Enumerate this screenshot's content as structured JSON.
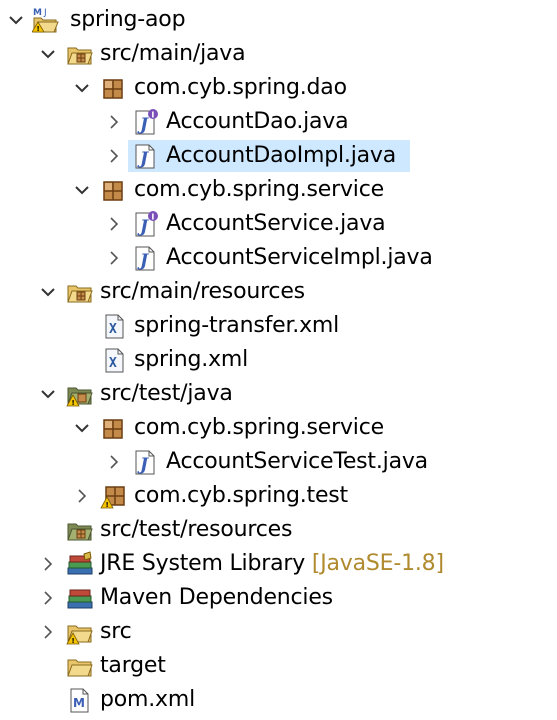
{
  "tree": {
    "project": "spring-aop",
    "main_java": "src/main/java",
    "pkg_dao": "com.cyb.spring.dao",
    "account_dao": "AccountDao.java",
    "account_dao_impl": "AccountDaoImpl.java",
    "pkg_service": "com.cyb.spring.service",
    "account_service": "AccountService.java",
    "account_service_impl": "AccountServiceImpl.java",
    "main_resources": "src/main/resources",
    "spring_transfer_xml": "spring-transfer.xml",
    "spring_xml": "spring.xml",
    "test_java": "src/test/java",
    "test_pkg_service": "com.cyb.spring.service",
    "account_service_test": "AccountServiceTest.java",
    "test_pkg_test": "com.cyb.spring.test",
    "test_resources": "src/test/resources",
    "jre_library": "JRE System Library",
    "jre_version": "[JavaSE-1.8]",
    "maven_deps": "Maven Dependencies",
    "src": "src",
    "target": "target",
    "pom": "pom.xml"
  },
  "colors": {
    "selection": "#cde8ff",
    "decoration": "#b08a2e",
    "package": "#8b5a2b",
    "folder": "#e8c56b",
    "warning": "#f5c400"
  },
  "icons": {
    "project": "maven-project-icon",
    "source_folder": "source-folder-icon",
    "package": "package-icon",
    "interface": "java-interface-icon",
    "class": "java-class-icon",
    "xml": "xml-file-icon",
    "library": "library-icon",
    "folder": "folder-icon",
    "pom": "maven-pom-icon"
  }
}
